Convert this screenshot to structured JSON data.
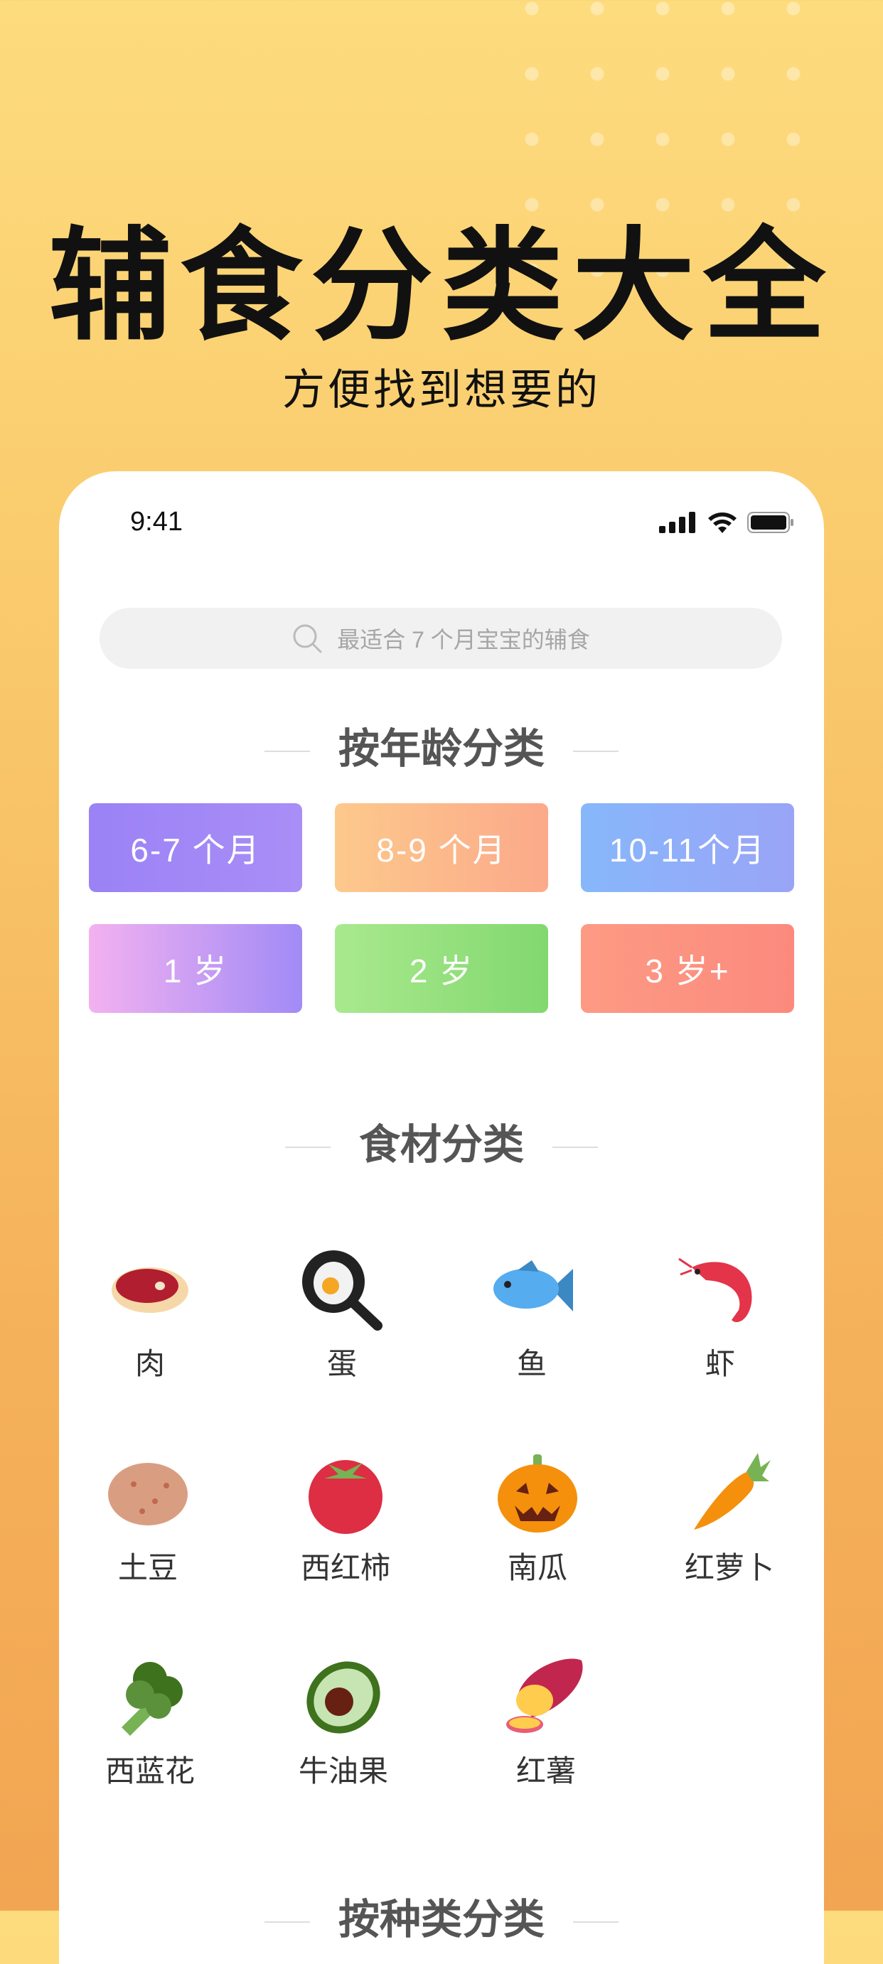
{
  "hero": {
    "title": "辅食分类大全",
    "subtitle": "方便找到想要的"
  },
  "status_bar": {
    "time": "9:41"
  },
  "search": {
    "placeholder": "最适合 7 个月宝宝的辅食"
  },
  "sections": {
    "age_title": "按年龄分类",
    "food_title": "食材分类",
    "next_title": "按种类分类"
  },
  "age_buttons": [
    {
      "label": "6-7 个月",
      "colors": [
        "#9b82f5",
        "#a98ef7"
      ]
    },
    {
      "label": "8-9 个月",
      "colors": [
        "#fdc98c",
        "#fba98a"
      ]
    },
    {
      "label": "10-11个月",
      "colors": [
        "#87b7fb",
        "#9aa4f7"
      ]
    },
    {
      "label": "1 岁",
      "colors": [
        "#f3b1f0",
        "#a18bf6"
      ]
    },
    {
      "label": "2 岁",
      "colors": [
        "#a9e98e",
        "#82d86f"
      ]
    },
    {
      "label": "3 岁+",
      "colors": [
        "#fd9a84",
        "#fb8a7d"
      ]
    }
  ],
  "food_items": [
    {
      "label": "肉",
      "icon": "meat-icon"
    },
    {
      "label": "蛋",
      "icon": "egg-pan-icon"
    },
    {
      "label": "鱼",
      "icon": "fish-icon"
    },
    {
      "label": "虾",
      "icon": "shrimp-icon"
    },
    {
      "label": "土豆",
      "icon": "potato-icon"
    },
    {
      "label": "西红柿",
      "icon": "tomato-icon"
    },
    {
      "label": "南瓜",
      "icon": "pumpkin-icon"
    },
    {
      "label": "红萝卜",
      "icon": "carrot-icon"
    },
    {
      "label": "西蓝花",
      "icon": "broccoli-icon"
    },
    {
      "label": "牛油果",
      "icon": "avocado-icon"
    },
    {
      "label": "红薯",
      "icon": "sweet-potato-icon"
    }
  ]
}
